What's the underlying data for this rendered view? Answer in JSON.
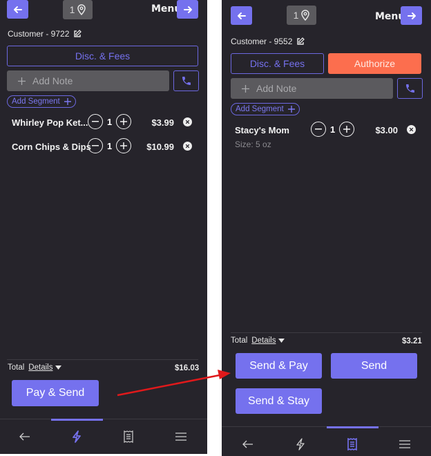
{
  "left_screen": {
    "header": {
      "location_count": "1",
      "menu_label": "Menu"
    },
    "customer_label": "Customer - 9722",
    "disc_fees_label": "Disc. & Fees",
    "add_note_placeholder": "Add Note",
    "add_segment_label": "Add Segment",
    "items": [
      {
        "name": "Whirley Pop Ket...",
        "qty": "1",
        "price": "$3.99"
      },
      {
        "name": "Corn Chips & Dips",
        "qty": "1",
        "price": "$10.99"
      }
    ],
    "total_label": "Total",
    "details_label": "Details",
    "total_amount": "$16.03",
    "pay_send_label": "Pay & Send",
    "nav": {
      "active": "quick-actions"
    }
  },
  "right_screen": {
    "header": {
      "location_count": "1",
      "menu_label": "Menu"
    },
    "customer_label": "Customer - 9552",
    "disc_fees_label": "Disc. & Fees",
    "authorize_label": "Authorize",
    "add_note_placeholder": "Add Note",
    "add_segment_label": "Add Segment",
    "items": [
      {
        "name": "Stacy's Mom",
        "sub": "Size: 5 oz",
        "qty": "1",
        "price": "$3.00"
      }
    ],
    "total_label": "Total",
    "details_label": "Details",
    "total_amount": "$3.21",
    "buttons": {
      "send_pay": "Send & Pay",
      "send": "Send",
      "send_stay": "Send & Stay"
    },
    "nav": {
      "active": "receipt"
    }
  },
  "colors": {
    "accent": "#7571ee",
    "authorize": "#fc6e4e",
    "background": "#26242b",
    "annotation_arrow": "#e0191b"
  }
}
